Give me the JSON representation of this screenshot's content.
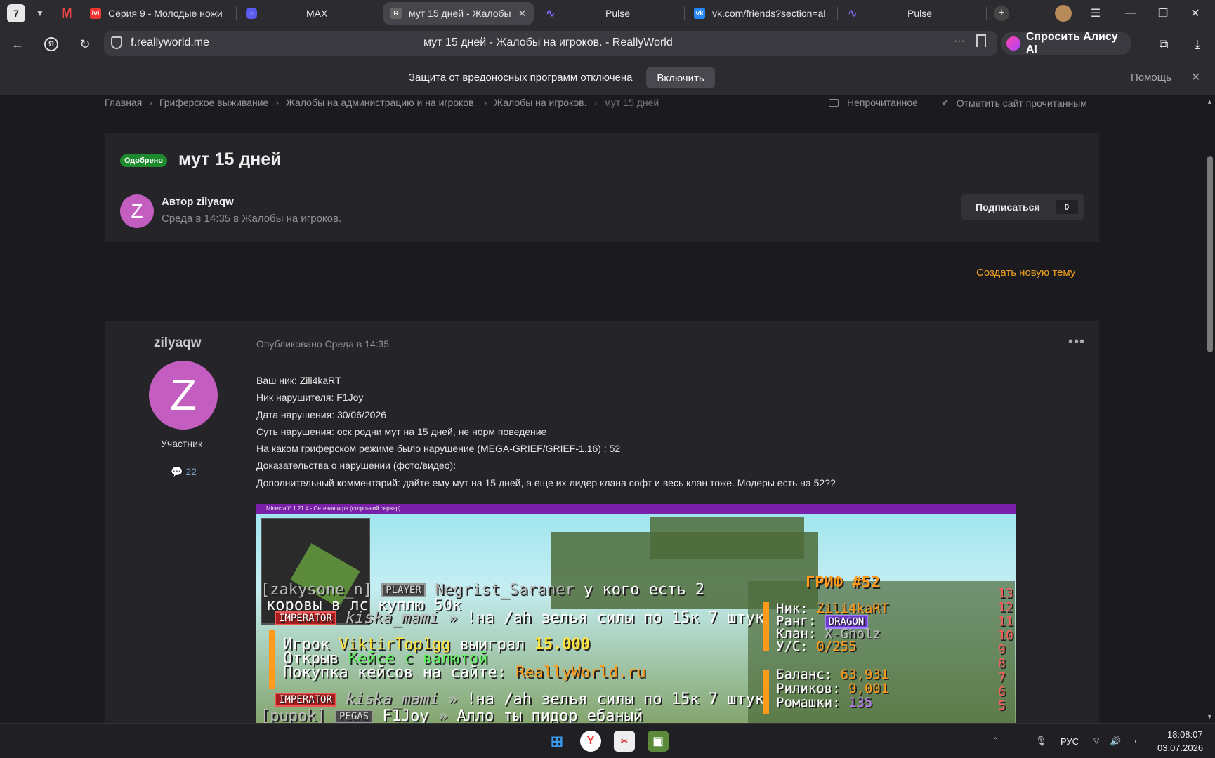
{
  "browser": {
    "tab_count": "7",
    "tabs": [
      {
        "label": "Серия 9 - Молодые ножи",
        "icon": "ivi-icon"
      },
      {
        "label": "MAX",
        "icon": "max-icon"
      },
      {
        "label": "мут 15 дней - Жалобы",
        "icon": "reallyworld-icon"
      },
      {
        "label": "Pulse",
        "icon": "pulse-icon"
      },
      {
        "label": "vk.com/friends?section=al",
        "icon": "vk-icon"
      },
      {
        "label": "Pulse",
        "icon": "pulse-icon"
      }
    ],
    "domain": "f.reallyworld.me",
    "page_title": "мут 15 дней - Жалобы на игроков. - ReallyWorld",
    "alice_label": "Спросить Алису AI",
    "infobar": {
      "text": "Защита от вредоносных программ отключена",
      "button": "Включить",
      "help": "Помощь"
    }
  },
  "breadcrumbs": [
    "Главная",
    "Гриферское выживание",
    "Жалобы на администрацию и на игроков.",
    "Жалобы на игроков.",
    "мут 15 дней"
  ],
  "crumb_actions": {
    "unread": "Непрочитанное",
    "mark_read": "Отметить сайт прочитанным"
  },
  "topic": {
    "badge": "Одобрено",
    "title": "мут 15 дней",
    "avatar_letter": "Z",
    "author_line": "Автор zilyaqw",
    "meta": "Среда в 14:35 в Жалобы на игроков.",
    "subscribe": "Подписаться",
    "subscribers": "0"
  },
  "new_topic": "Создать новую тему",
  "post": {
    "username": "zilyaqw",
    "avatar_letter": "Z",
    "role": "Участник",
    "post_count": "22",
    "published": "Опубликовано Среда в 14:35",
    "lines": [
      "Ваш ник: Zili4kaRT",
      "Ник нарушителя: F1Joy",
      "Дата нарушения: 30/06/2026",
      "Суть нарушения: оск родни мут на 15 дней, не норм поведение",
      "На каком гриферском режиме было нарушение (MEGA-GRIEF/GRIEF-1.16) : 52",
      "Доказательства о нарушении (фото/видео):",
      "Дополнительный комментарий: дайте ему мут на 15 дней, а еще их лидер клана софт и весь клан тоже. Модеры есть на 52??"
    ]
  },
  "screenshot": {
    "window_title": "Minecraft* 1.21.4 - Сетевая игра (сторонний сервер)",
    "chat": [
      {
        "prefix": "[zakysone_n]",
        "rank": "PLAYER",
        "name": "Negrist_Saraner",
        "msg": "у кого есть 2"
      },
      {
        "msg": "коровы в лс куплю 50к"
      },
      {
        "rank": "IMPERATOR",
        "name": "kiska_mami",
        "msg": "!на /ah зелья силы по 15к 7 штук"
      },
      {
        "text1": "Игрок",
        "player": "ViktirTop1gg",
        "text2": "выиграл",
        "amount": "15.000"
      },
      {
        "text1": "Открыв",
        "case": "Кейсе с валютой"
      },
      {
        "text1": "Покупка кейсов на сайте:",
        "site": "ReallyWorld.ru"
      },
      {
        "rank": "IMPERATOR",
        "name": "kiska_mami",
        "msg": "!на /ah зелья силы по 15к 7 штук"
      },
      {
        "prefix": "[pupok]",
        "rank": "PEGAS",
        "name": "F1Joy",
        "msg": "Алло ты пидор ебаный"
      }
    ],
    "sidebar": {
      "title": "ГРИФ #52",
      "nick_label": "Ник:",
      "nick": "Zili4kaRT",
      "rank_label": "Ранг:",
      "rank": "DRAGON",
      "clan_label": "Клан:",
      "clan": "X-Gholz",
      "kd_label": "У/С:",
      "kd": "0/255",
      "balance_label": "Баланс:",
      "balance": "63,931",
      "rillik_label": "Риликов:",
      "rillik": "9,001",
      "romashki_label": "Ромашки:",
      "romashki": "135",
      "numbers": [
        "13",
        "12",
        "11",
        "10",
        "9",
        "8",
        "7",
        "6",
        "5"
      ]
    }
  },
  "taskbar": {
    "lang": "РУС",
    "time": "18:08:07",
    "date": "03.07.2026"
  }
}
